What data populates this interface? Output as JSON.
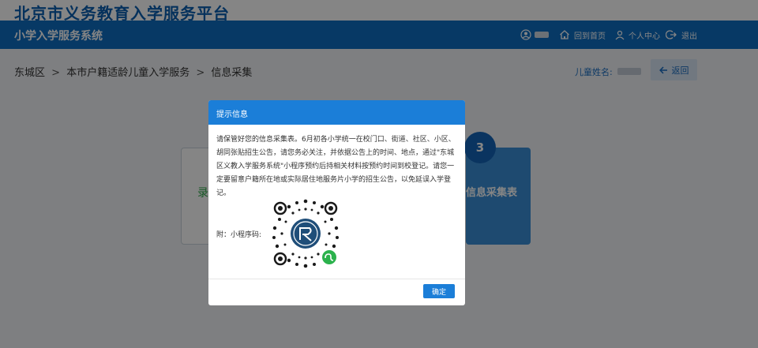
{
  "site": {
    "brand_title": "北京市义务教育入学服务平台",
    "system_title": "小学入学服务系统"
  },
  "nav": {
    "items": [
      {
        "icon": "user-circle-icon",
        "label": ""
      },
      {
        "icon": "home-icon",
        "label": "回到首页"
      },
      {
        "icon": "person-icon",
        "label": "个人中心"
      },
      {
        "icon": "logout-icon",
        "label": "退出"
      }
    ]
  },
  "breadcrumb": [
    "东城区",
    "本市户籍适龄儿童入学服务",
    "信息采集"
  ],
  "breadcrumb_separator": ">",
  "child": {
    "label": "儿童姓名:",
    "value": ""
  },
  "back_button": {
    "label": "返回",
    "icon": "arrow-left-icon"
  },
  "steps": {
    "left_card_text": "录",
    "active_step_number": "3",
    "active_step_label": "信息采集表"
  },
  "modal": {
    "title": "提示信息",
    "message": "请保管好您的信息采集表。6月初各小学统一在校门口、街道、社区、小区、胡同张贴招生公告，请您务必关注，并依据公告上的时间、地点，通过\"东城区义教入学服务系统\"小程序预约后持相关材料按预约时间到校登记。请您一定要留意户籍所在地或实际居住地服务片小学的招生公告，以免延误入学登记。",
    "attachment_label": "附：小程序码:",
    "qr_icon": "wechat-mini-program-code",
    "ok_label": "确定"
  },
  "colors": {
    "brand": "#0a5fb0",
    "nav_bg": "#0f6dc2",
    "modal_header": "#1b7ed8",
    "step_active": "#3a8fd6",
    "step_done_text": "#2aa745"
  }
}
